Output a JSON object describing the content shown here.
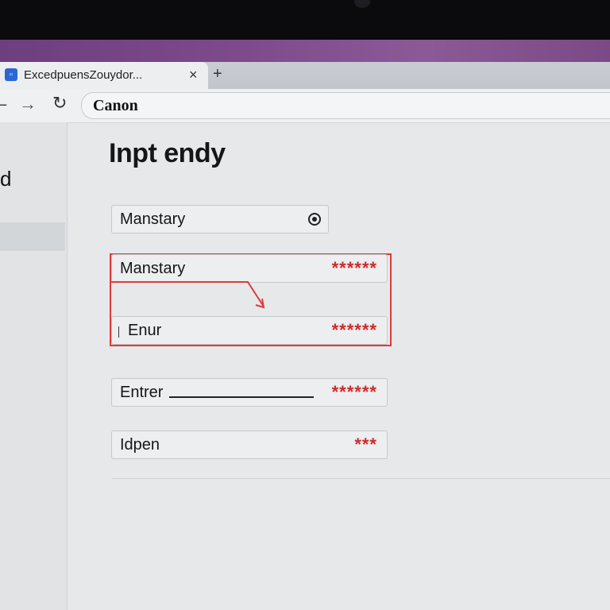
{
  "browser": {
    "tab": {
      "title": "ExcedpuensZouydor...",
      "favicon": "blue-square-icon"
    },
    "address": "Canon",
    "icons": [
      "back-arrow-icon",
      "forward-arrow-icon",
      "reload-icon",
      "close-icon",
      "plus-icon"
    ]
  },
  "sidebar": {
    "items": [
      {
        "label": "d"
      }
    ]
  },
  "page": {
    "title": "Inpt endy",
    "fields": [
      {
        "label": "Manstary",
        "required": "",
        "icon": "eye-icon"
      },
      {
        "label": "Manstary",
        "required": "******"
      },
      {
        "label": "Enur",
        "required": "******"
      },
      {
        "label": "Entrer",
        "required": "******"
      },
      {
        "label": "Idpen",
        "required": "***"
      }
    ]
  },
  "colors": {
    "accent_red": "#e03a3a",
    "required_red": "#cf2a2a",
    "window_bg": "#e6e8ea",
    "wallpaper_purple": "#7e4a8c"
  }
}
